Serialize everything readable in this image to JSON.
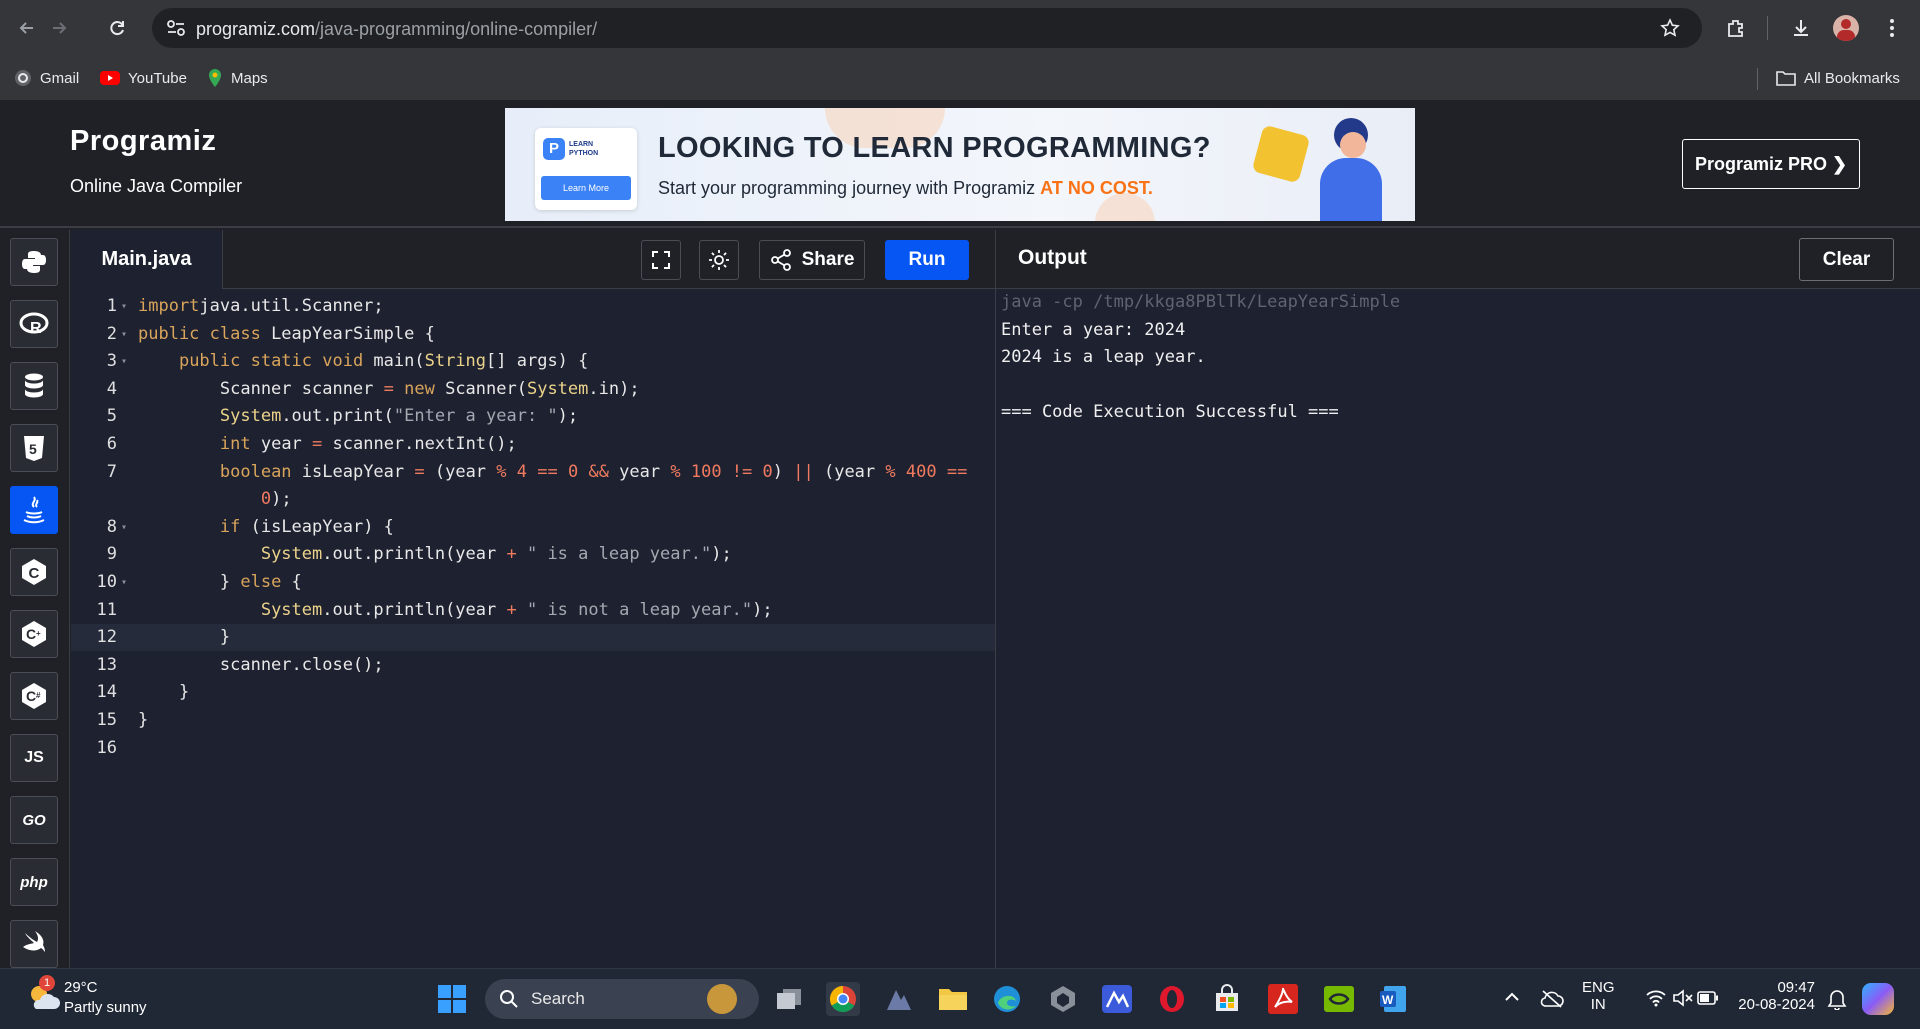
{
  "browser": {
    "url_host": "programiz.com",
    "url_path": "/java-programming/online-compiler/",
    "bookmarks": [
      "Gmail",
      "YouTube",
      "Maps"
    ],
    "all_bookmarks": "All Bookmarks"
  },
  "site": {
    "logo": "Programiz",
    "subtitle": "Online Java Compiler",
    "pro_button": "Programiz PRO ❯",
    "ad": {
      "badge_line1": "LEARN",
      "badge_line2": "PYTHON",
      "badge_button": "Learn More",
      "headline": "LOOKING TO LEARN PROGRAMMING?",
      "sub": "Start your programming journey with Programiz",
      "sub_highlight": "AT NO COST."
    }
  },
  "languages": [
    {
      "name": "python-icon",
      "label": ""
    },
    {
      "name": "r-icon",
      "label": "R"
    },
    {
      "name": "sql-icon",
      "label": ""
    },
    {
      "name": "html5-icon",
      "label": "5"
    },
    {
      "name": "java-icon",
      "label": "",
      "active": true
    },
    {
      "name": "c-icon",
      "label": "C"
    },
    {
      "name": "cpp-icon",
      "label": "C"
    },
    {
      "name": "csharp-icon",
      "label": "C"
    },
    {
      "name": "js-icon",
      "label": "JS"
    },
    {
      "name": "go-icon",
      "label": "GO"
    },
    {
      "name": "php-icon",
      "label": "php"
    },
    {
      "name": "swift-icon",
      "label": ""
    }
  ],
  "editor": {
    "file_tab": "Main.java",
    "share": "Share",
    "run": "Run",
    "lines": [
      {
        "n": "1",
        "fold": true,
        "segs": [
          [
            "kw",
            "import"
          ],
          [
            "",
            "java.util.Scanner;"
          ]
        ]
      },
      {
        "n": "2",
        "fold": true,
        "segs": [
          [
            "kw",
            "public class"
          ],
          [
            "",
            " LeapYearSimple {"
          ]
        ]
      },
      {
        "n": "3",
        "fold": true,
        "segs": [
          [
            "",
            "    "
          ],
          [
            "kw",
            "public static void"
          ],
          [
            "",
            " main("
          ],
          [
            "cls",
            "String"
          ],
          [
            "",
            "[] args) {"
          ]
        ]
      },
      {
        "n": "4",
        "segs": [
          [
            "",
            "        Scanner scanner "
          ],
          [
            "op",
            "="
          ],
          [
            "kw",
            " new"
          ],
          [
            "",
            " Scanner("
          ],
          [
            "cls",
            "System"
          ],
          [
            "",
            ".in);"
          ]
        ]
      },
      {
        "n": "5",
        "segs": [
          [
            "",
            "        "
          ],
          [
            "cls",
            "System"
          ],
          [
            "",
            ".out.print("
          ],
          [
            "str",
            "\"Enter a year: \""
          ],
          [
            "",
            ");"
          ]
        ]
      },
      {
        "n": "6",
        "segs": [
          [
            "",
            "        "
          ],
          [
            "kw",
            "int"
          ],
          [
            "",
            " year "
          ],
          [
            "op",
            "="
          ],
          [
            "",
            " scanner.nextInt();"
          ]
        ]
      },
      {
        "n": "7",
        "segs": [
          [
            "",
            "        "
          ],
          [
            "kw",
            "boolean"
          ],
          [
            "",
            " isLeapYear "
          ],
          [
            "op",
            "="
          ],
          [
            "",
            " (year "
          ],
          [
            "op",
            "%"
          ],
          [
            "num",
            " 4"
          ],
          [
            "op",
            " =="
          ],
          [
            "num",
            " 0"
          ],
          [
            "op",
            " &&"
          ],
          [
            "",
            " year "
          ],
          [
            "op",
            "%"
          ],
          [
            "num",
            " 100"
          ],
          [
            "op",
            " !="
          ],
          [
            "num",
            " 0"
          ],
          [
            "",
            ") "
          ],
          [
            "op",
            "||"
          ],
          [
            "",
            " (year "
          ],
          [
            "op",
            "%"
          ],
          [
            "num",
            " 400"
          ],
          [
            "op",
            " =="
          ]
        ]
      },
      {
        "n": "",
        "segs": [
          [
            "",
            "            "
          ],
          [
            "num",
            "0"
          ],
          [
            "",
            ");"
          ]
        ]
      },
      {
        "n": "8",
        "fold": true,
        "segs": [
          [
            "",
            "        "
          ],
          [
            "kw",
            "if"
          ],
          [
            "",
            " (isLeapYear) {"
          ]
        ]
      },
      {
        "n": "9",
        "segs": [
          [
            "",
            "            "
          ],
          [
            "cls",
            "System"
          ],
          [
            "",
            ".out.println(year "
          ],
          [
            "op",
            "+"
          ],
          [
            "str",
            " \" is a leap year.\""
          ],
          [
            "",
            ");"
          ]
        ]
      },
      {
        "n": "10",
        "fold": true,
        "segs": [
          [
            "",
            "        } "
          ],
          [
            "kw",
            "else"
          ],
          [
            "",
            " {"
          ]
        ]
      },
      {
        "n": "11",
        "segs": [
          [
            "",
            "            "
          ],
          [
            "cls",
            "System"
          ],
          [
            "",
            ".out.println(year "
          ],
          [
            "op",
            "+"
          ],
          [
            "str",
            " \" is not a leap year.\""
          ],
          [
            "",
            ");"
          ]
        ]
      },
      {
        "n": "12",
        "active": true,
        "segs": [
          [
            "",
            "        }"
          ]
        ]
      },
      {
        "n": "13",
        "segs": [
          [
            "",
            "        scanner.close();"
          ]
        ]
      },
      {
        "n": "14",
        "segs": [
          [
            "",
            "    }"
          ]
        ]
      },
      {
        "n": "15",
        "segs": [
          [
            "",
            "}"
          ]
        ]
      },
      {
        "n": "16",
        "segs": [
          [
            "",
            ""
          ]
        ]
      }
    ]
  },
  "output": {
    "title": "Output",
    "clear": "Clear",
    "command": "java -cp /tmp/kkga8PBlTk/LeapYearSimple",
    "lines": [
      "Enter a year: 2024",
      "2024 is a leap year.",
      "",
      "=== Code Execution Successful ==="
    ]
  },
  "taskbar": {
    "weather_badge": "1",
    "temp": "29°C",
    "condition": "Partly sunny",
    "search": "Search",
    "lang_top": "ENG",
    "lang_bottom": "IN",
    "time": "09:47",
    "date": "20-08-2024"
  },
  "colors": {
    "accent": "#0556f3",
    "editor_bg": "#1e2130",
    "chrome_bg": "#35363a",
    "keyword": "#d9a45b",
    "string": "#a4a8b0",
    "operator": "#f07a5f"
  }
}
